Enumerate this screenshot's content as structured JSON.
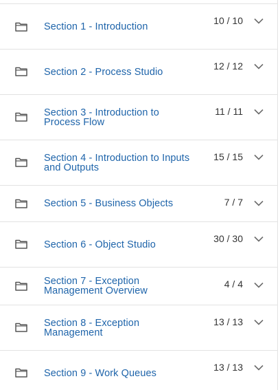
{
  "sections": [
    {
      "title": "Section 1 - Introduction",
      "count": "10 / 10",
      "icon": "folder-icon",
      "expand_icon": "chevron-down-icon"
    },
    {
      "title": "Section 2 - Process Studio",
      "count": "12 / 12",
      "icon": "folder-icon",
      "expand_icon": "chevron-down-icon"
    },
    {
      "title": "Section 3 - Introduction to Process Flow",
      "count": "11 / 11",
      "icon": "folder-icon",
      "expand_icon": "chevron-down-icon"
    },
    {
      "title": "Section 4 - Introduction to Inputs and Outputs",
      "count": "15 / 15",
      "icon": "folder-icon",
      "expand_icon": "chevron-down-icon"
    },
    {
      "title": "Section 5 - Business Objects",
      "count": "7 / 7",
      "icon": "folder-icon",
      "expand_icon": "chevron-down-icon"
    },
    {
      "title": "Section 6 - Object Studio",
      "count": "30 / 30",
      "icon": "folder-icon",
      "expand_icon": "chevron-down-icon"
    },
    {
      "title": "Section 7 - Exception Management Overview",
      "count": "4 / 4",
      "icon": "folder-icon",
      "expand_icon": "chevron-down-icon"
    },
    {
      "title": "Section 8 - Exception Management",
      "count": "13 / 13",
      "icon": "folder-icon",
      "expand_icon": "chevron-down-icon"
    },
    {
      "title": "Section 9 - Work Queues",
      "count": "13 / 13",
      "icon": "folder-icon",
      "expand_icon": "chevron-down-icon"
    }
  ],
  "colors": {
    "link": "#1e64aa",
    "text": "#333333",
    "icon": "#555555",
    "chevron": "#6b6b6b",
    "divider": "#e2e2e2"
  }
}
